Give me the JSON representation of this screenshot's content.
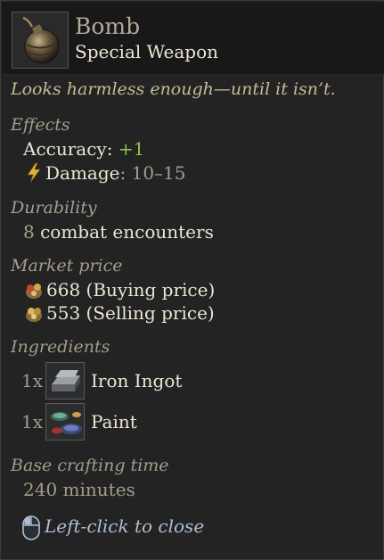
{
  "item": {
    "name": "Bomb",
    "type": "Special Weapon",
    "icon": "bomb-icon",
    "flavor": "Looks harmless enough—until it isn’t."
  },
  "effects": {
    "label": "Effects",
    "accuracy_label": "Accuracy",
    "accuracy_value": "+1",
    "damage_icon": "lightning-icon",
    "damage_label": "Damage",
    "damage_value": "10–15"
  },
  "durability": {
    "label": "Durability",
    "value": "8",
    "unit": "combat encounters"
  },
  "market": {
    "label": "Market price",
    "buy_icon": "coin-pouch-icon",
    "buy_text": "668 (Buying price)",
    "sell_icon": "coin-pouch-icon",
    "sell_text": "553 (Selling price)"
  },
  "ingredients": {
    "label": "Ingredients",
    "items": [
      {
        "qty": "1x",
        "name": "Iron Ingot",
        "icon": "iron-ingot-icon"
      },
      {
        "qty": "1x",
        "name": "Paint",
        "icon": "paint-icon"
      }
    ]
  },
  "crafting": {
    "label": "Base crafting time",
    "value": "240 minutes"
  },
  "close_hint": {
    "icon": "mouse-icon",
    "text": "Left-click to close"
  },
  "colors": {
    "background": "#232323",
    "header": "#181818",
    "positive": "#8cc452",
    "hint": "#aebfd2"
  }
}
